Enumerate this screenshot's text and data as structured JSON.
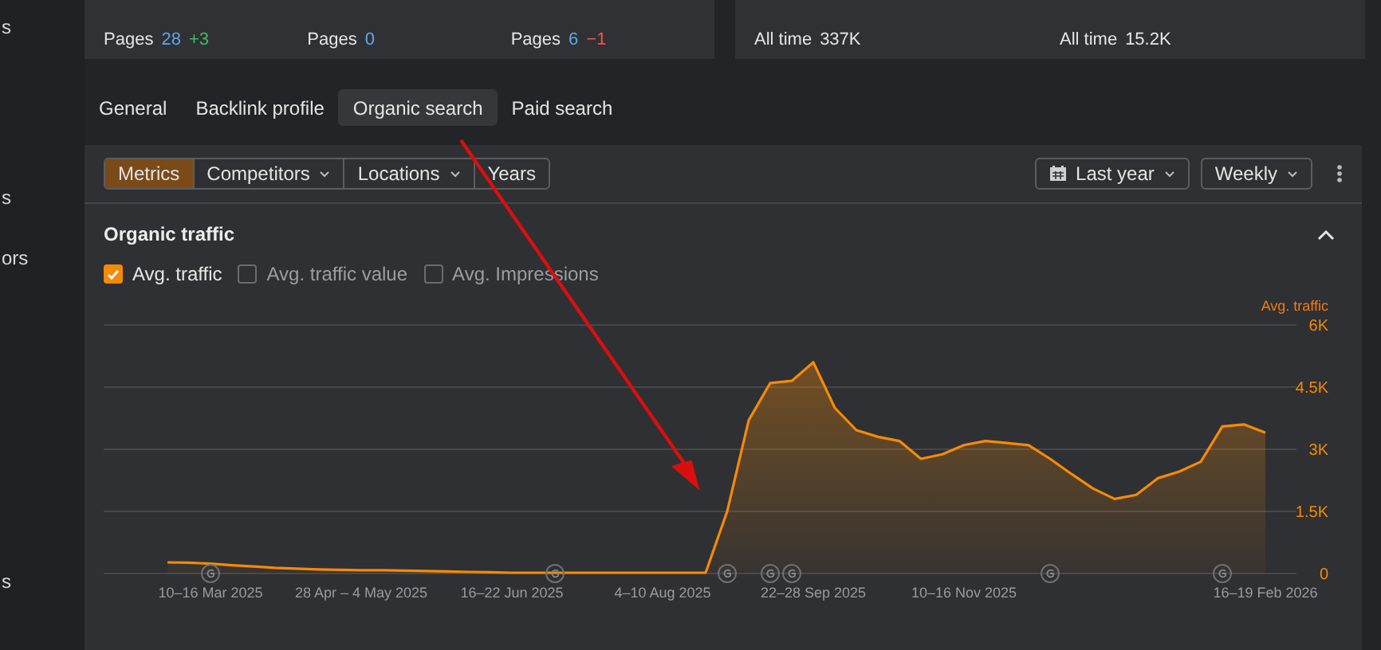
{
  "sidebar": {
    "items": [
      "s",
      "s",
      "ors",
      "s"
    ]
  },
  "summary_cards": [
    {
      "metrics": [
        {
          "kind": "increase",
          "label": "Pages",
          "value": "28",
          "change": "+3"
        },
        {
          "kind": "plain",
          "label": "Pages",
          "value": "0"
        },
        {
          "kind": "decrease",
          "label": "Pages",
          "value": "6",
          "change": "−1"
        }
      ]
    },
    {
      "metrics": [
        {
          "label": "All time",
          "value": "337K"
        },
        {
          "label": "All time",
          "value": "15.2K"
        }
      ]
    }
  ],
  "tabs": [
    {
      "label": "General",
      "selected": false
    },
    {
      "label": "Backlink profile",
      "selected": false
    },
    {
      "label": "Organic search",
      "selected": true
    },
    {
      "label": "Paid search",
      "selected": false
    }
  ],
  "toolbar": {
    "segments": [
      {
        "label": "Metrics",
        "selected": true,
        "dropdown": false
      },
      {
        "label": "Competitors",
        "selected": false,
        "dropdown": true
      },
      {
        "label": "Locations",
        "selected": false,
        "dropdown": true
      },
      {
        "label": "Years",
        "selected": false,
        "dropdown": false
      }
    ],
    "period": "Last year",
    "granularity": "Weekly"
  },
  "section": {
    "title": "Organic traffic",
    "expanded": true,
    "metric_toggles": [
      {
        "label": "Avg. traffic",
        "checked": true
      },
      {
        "label": "Avg. traffic value",
        "checked": false
      },
      {
        "label": "Avg. Impressions",
        "checked": false
      }
    ],
    "chart_data": {
      "type": "area",
      "grid": true,
      "ylim": [
        0,
        6000
      ],
      "categories": [
        null,
        null,
        "10–16 Mar 2025",
        null,
        null,
        null,
        null,
        null,
        null,
        "28 Apr – 4 May 2025",
        null,
        null,
        null,
        null,
        null,
        null,
        "16–22 Jun 2025",
        null,
        null,
        null,
        null,
        null,
        null,
        "4–10 Aug 2025",
        null,
        null,
        null,
        null,
        null,
        null,
        "22–28 Sep 2025",
        null,
        null,
        null,
        null,
        null,
        null,
        "10–16 Nov 2025",
        null,
        null,
        null,
        null,
        null,
        null,
        null,
        null,
        null,
        null,
        null,
        null,
        null,
        "16–19 Feb 2026"
      ],
      "yticks": [
        {
          "value": 0,
          "label": "0"
        },
        {
          "value": 1500,
          "label": "1.5K"
        },
        {
          "value": 3000,
          "label": "3K"
        },
        {
          "value": 4500,
          "label": "4.5K"
        },
        {
          "value": 6000,
          "label": "6K"
        }
      ],
      "series": [
        {
          "name": "Avg. traffic",
          "color": "#f58a07",
          "values": [
            270,
            260,
            240,
            200,
            170,
            140,
            120,
            100,
            90,
            80,
            80,
            70,
            60,
            50,
            40,
            30,
            20,
            20,
            20,
            20,
            20,
            20,
            20,
            20,
            20,
            20,
            1500,
            3700,
            4600,
            4650,
            5100,
            4000,
            3460,
            3300,
            3200,
            2770,
            2880,
            3100,
            3200,
            3150,
            3100,
            2770,
            2400,
            2050,
            1800,
            1900,
            2300,
            2460,
            2700,
            3550,
            3600,
            3400
          ]
        }
      ]
    }
  },
  "annotation_arrow": {
    "color": "#d90f0f"
  }
}
